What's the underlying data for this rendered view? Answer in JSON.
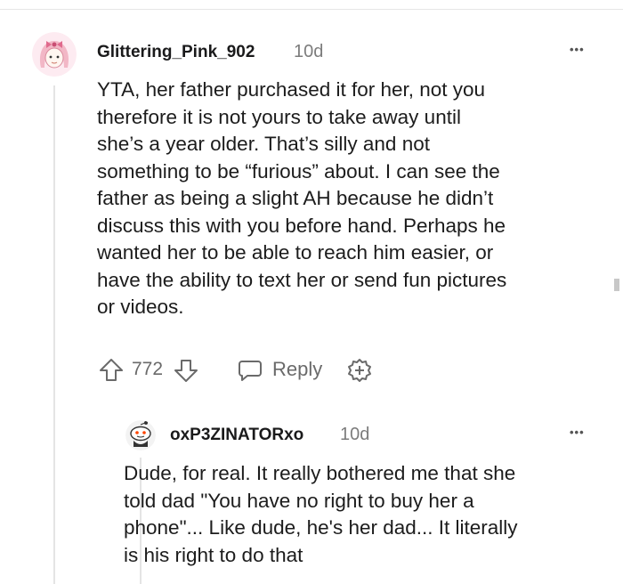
{
  "comments": [
    {
      "username": "Glittering_Pink_902",
      "age": "10d",
      "more": "•••",
      "body": [
        "YTA, her father purchased it for her, not you",
        "therefore it is not yours to take away until",
        "she’s a year older. That’s silly and not",
        "something to be “furious” about. I can see the",
        "father as being a slight AH because he didn’t",
        "discuss this with you before hand. Perhaps he",
        "wanted her to be able to reach him easier, or",
        "have the ability to text her or send fun pictures",
        "or videos."
      ],
      "votes": "772",
      "reply_label": "Reply"
    },
    {
      "username": "oxP3ZINATORxo",
      "age": "10d",
      "more": "•••",
      "body": [
        "Dude, for real. It really bothered me that she",
        "told dad \"You have no right to buy her a",
        "phone\"... Like dude, he's her dad... It literally",
        "is his right to do that"
      ]
    }
  ],
  "colors": {
    "accent_pink": "#e9a3b5",
    "text": "#1c1c1c",
    "muted": "#7c7c7c"
  }
}
